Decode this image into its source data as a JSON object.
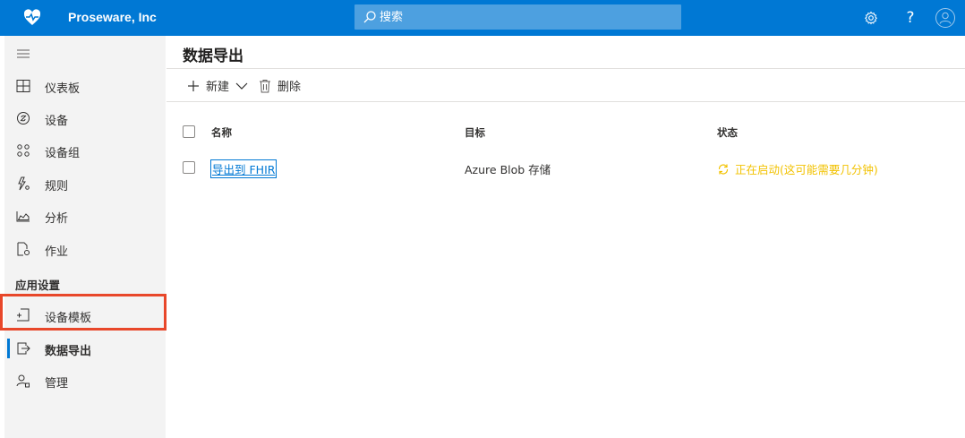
{
  "topbar": {
    "brand_name": "Proseware, Inc",
    "search_placeholder": "搜索",
    "icons": [
      "heart-pulse-icon",
      "search-icon",
      "gear-icon",
      "help-icon",
      "user-avatar-icon"
    ],
    "help_label": "?",
    "colors": {
      "bar": "#0078d4",
      "search_bg": "#4da0e0"
    }
  },
  "sidebar": {
    "items": [
      {
        "label": "仪表板",
        "icon": "dashboard-icon"
      },
      {
        "label": "设备",
        "icon": "device-icon"
      },
      {
        "label": "设备组",
        "icon": "device-groups-icon"
      },
      {
        "label": "规则",
        "icon": "rules-icon"
      },
      {
        "label": "分析",
        "icon": "analytics-icon"
      },
      {
        "label": "作业",
        "icon": "jobs-icon"
      }
    ],
    "section_label": "应用设置",
    "settings_items": [
      {
        "label": "设备模板",
        "icon": "device-template-icon"
      },
      {
        "label": "数据导出",
        "icon": "data-export-icon",
        "active": true
      },
      {
        "label": "管理",
        "icon": "administration-icon"
      }
    ],
    "colors": {
      "bg": "#f3f3f3",
      "active_bar": "#0078d4",
      "highlight": "#e8472a"
    }
  },
  "main": {
    "title": "数据导出",
    "toolbar": {
      "new_label": "新建",
      "delete_label": "删除"
    },
    "table": {
      "columns": [
        "名称",
        "目标",
        "状态"
      ],
      "rows": [
        {
          "name": "导出到 FHIR",
          "destination": "Azure Blob 存储",
          "status": "正在启动(这可能需要几分钟)"
        }
      ]
    },
    "colors": {
      "link": "#0078d4",
      "status_pending": "#f2c200"
    }
  }
}
